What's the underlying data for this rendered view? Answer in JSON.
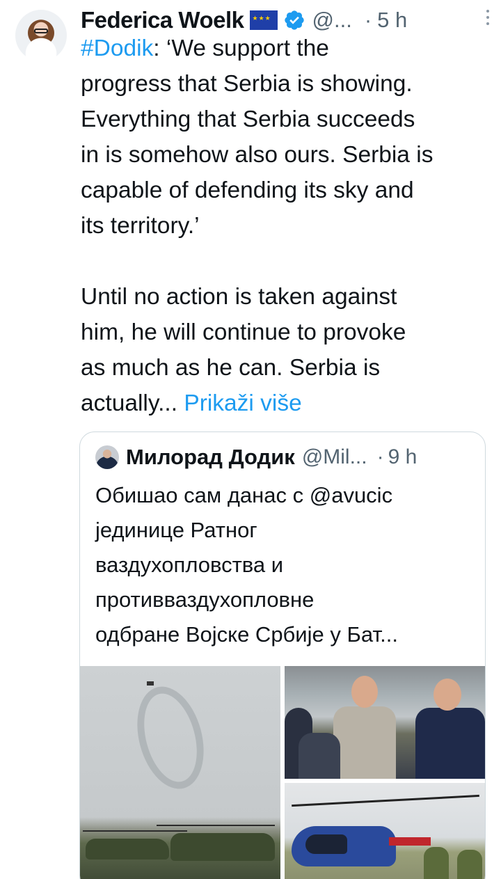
{
  "author": {
    "name": "Federica Woelk",
    "handle": "@...",
    "separator": "·",
    "time": "5 h"
  },
  "tweet": {
    "hashtag": "#Dodik",
    "line1_rest": ": ‘We support the",
    "lines": [
      "progress that Serbia is showing.",
      "Everything that Serbia succeeds",
      "in is somehow also ours. Serbia is",
      "capable of defending its sky and",
      "its territory.’"
    ],
    "para2_lines": [
      "Until no action is taken against",
      "him, he will continue to provoke",
      "as much as he can. Serbia is"
    ],
    "last_line_text": "actually...",
    "show_more": "Prikaži više"
  },
  "quote": {
    "name": "Милорад Додик",
    "handle": "@Mil...",
    "separator": "·",
    "time": "9 h",
    "lines": [
      "Обишао сам данас с @avucic",
      "јединице Ратног",
      "ваздухопловства и",
      "противваздухопловне",
      "одбране Војске Србије у Бат..."
    ]
  },
  "icons": {
    "flag": "eu-flag-icon",
    "verified": "verified-badge-icon",
    "more": "more-vertical-icon"
  },
  "colors": {
    "link": "#1d9bf0",
    "secondary_text": "#536471",
    "verified": "#1d9bf0",
    "border": "#cfd9de"
  }
}
